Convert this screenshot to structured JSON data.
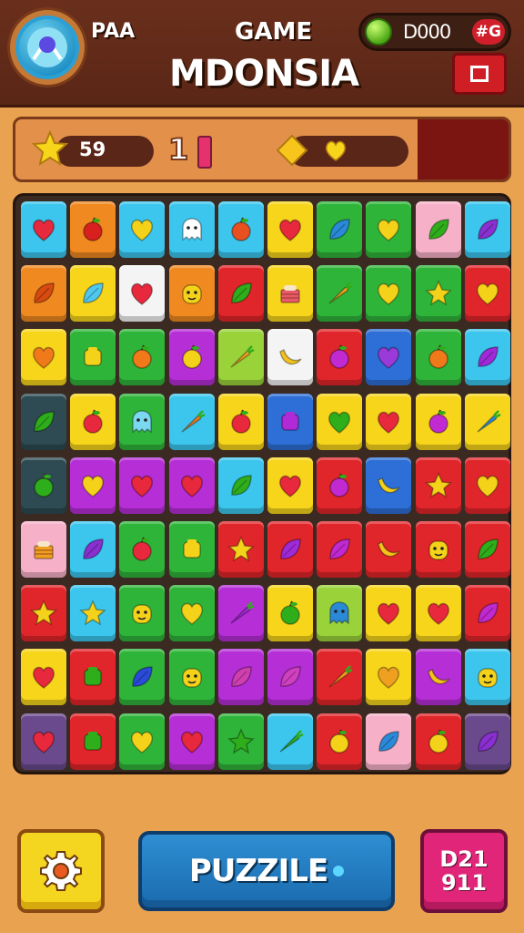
{
  "header": {
    "player_label": "PAA",
    "game_label": "GAME",
    "title": "MDONSIA",
    "coins": "D000",
    "coins_extra": "#G",
    "menu_icon": "square-menu-icon"
  },
  "stats": {
    "score": "59",
    "level_label": "1",
    "star_icon": "star-icon",
    "bonus_icon": "heart-icon"
  },
  "board": {
    "rows": 9,
    "cols": 10,
    "tiles": [
      [
        "cyan:heart:#e8283c",
        "orange:apple:#d8201e",
        "cyan:heart:#f5d21a",
        "cyan:ghost:#ffffff",
        "cyan:apple:#e85020",
        "yellow:heart:#e8283c",
        "green:leaf:#2a8ad8",
        "green:heart:#f5d21a",
        "pink:leaf:#2fae1c",
        "cyan:leaf:#8a2fd0"
      ],
      [
        "orange:leaf:#d84a10",
        "yellow:leaf:#4fc8f0",
        "white:heart:#e8283c",
        "orange:face:#f5d21a",
        "red:leaf:#2fae1c",
        "yellow:cake:#e85a6a",
        "green:carrot:#f0a020",
        "green:heart:#f5d21a",
        "green:star:#f5d21a",
        "red:heart:#f5d21a"
      ],
      [
        "yellow:heart:#f07a1a",
        "green:box:#f5d21a",
        "green:apple:#f07a1a",
        "magenta:apple:#f5d21a",
        "lime:carrot:#f0a020",
        "white:banana:#f5c21a",
        "red:apple:#c02ad0",
        "blue:heart:#9a3ad8",
        "green:apple:#f07a1a",
        "cyan:leaf:#a02ad8"
      ],
      [
        "dark:leaf:#2fae1c",
        "yellow:apple:#e8283c",
        "green:ghost:#7ad8f0",
        "cyan:carrot:#f07a1a",
        "yellow:apple:#e8283c",
        "blue:box:#b02ad8",
        "yellow:heart:#2fae1c",
        "yellow:heart:#e8283c",
        "yellow:apple:#c02ad0",
        "yellow:carrot:#2a8ad8"
      ],
      [
        "dark:apple:#2fae1c",
        "magenta:heart:#f5d21a",
        "magenta:heart:#e8283c",
        "magenta:heart:#e8283c",
        "cyan:leaf:#2fae1c",
        "yellow:heart:#e8283c",
        "red:apple:#c02ad0",
        "blue:banana:#f5d21a",
        "red:star:#f5d21a",
        "red:heart:#f5d21a"
      ],
      [
        "pink:cake:#f0a020",
        "cyan:leaf:#8a2fd0",
        "green:apple:#e8283c",
        "green:box:#f5d21a",
        "red:star:#f5d21a",
        "red:leaf:#a02ad8",
        "red:leaf:#c02ad0",
        "red:banana:#f5c21a",
        "red:face:#f5d21a",
        "red:leaf:#2fae1c"
      ],
      [
        "red:star:#f5d21a",
        "cyan:star:#f5d21a",
        "green:face:#f5d21a",
        "green:heart:#f5d21a",
        "magenta:carrot:#a02ad8",
        "yellow:apple:#2fae1c",
        "lime:ghost:#2a8ad8",
        "yellow:heart:#e8283c",
        "yellow:heart:#e8283c",
        "red:leaf:#c02ad0"
      ],
      [
        "yellow:heart:#e8283c",
        "red:box:#2fae1c",
        "green:leaf:#2a4ad8",
        "green:face:#f5d21a",
        "magenta:leaf:#d040b0",
        "magenta:leaf:#d040c0",
        "red:carrot:#f0a020",
        "yellow:heart:#f0a020",
        "magenta:banana:#f5c21a",
        "cyan:face:#f5d21a"
      ],
      [
        "purple:heart:#e8283c",
        "red:box:#2fae1c",
        "green:heart:#f5d21a",
        "magenta:heart:#e8283c",
        "green:star:#2fae1c",
        "cyan:carrot:#2fae1c",
        "red:apple:#f5d21a",
        "pink:leaf:#2a8ad8",
        "red:apple:#f5d21a",
        "purple:leaf:#8a2fd0"
      ]
    ]
  },
  "footer": {
    "settings_icon": "gear-icon",
    "puzzle_label": "PUZZILE",
    "level_line1": "D21",
    "level_line2": "911"
  },
  "colors": {
    "cyan": "#3cc6ee",
    "orange": "#f0891f",
    "yellow": "#f7d51b",
    "green": "#2fb43a",
    "red": "#e0262a",
    "magenta": "#b52ed6",
    "white": "#f4f4f4",
    "pink": "#f6b0c8",
    "blue": "#2d6fd6",
    "lime": "#9ad23a",
    "dark": "#2e4a52",
    "purple": "#6a4a8c"
  }
}
